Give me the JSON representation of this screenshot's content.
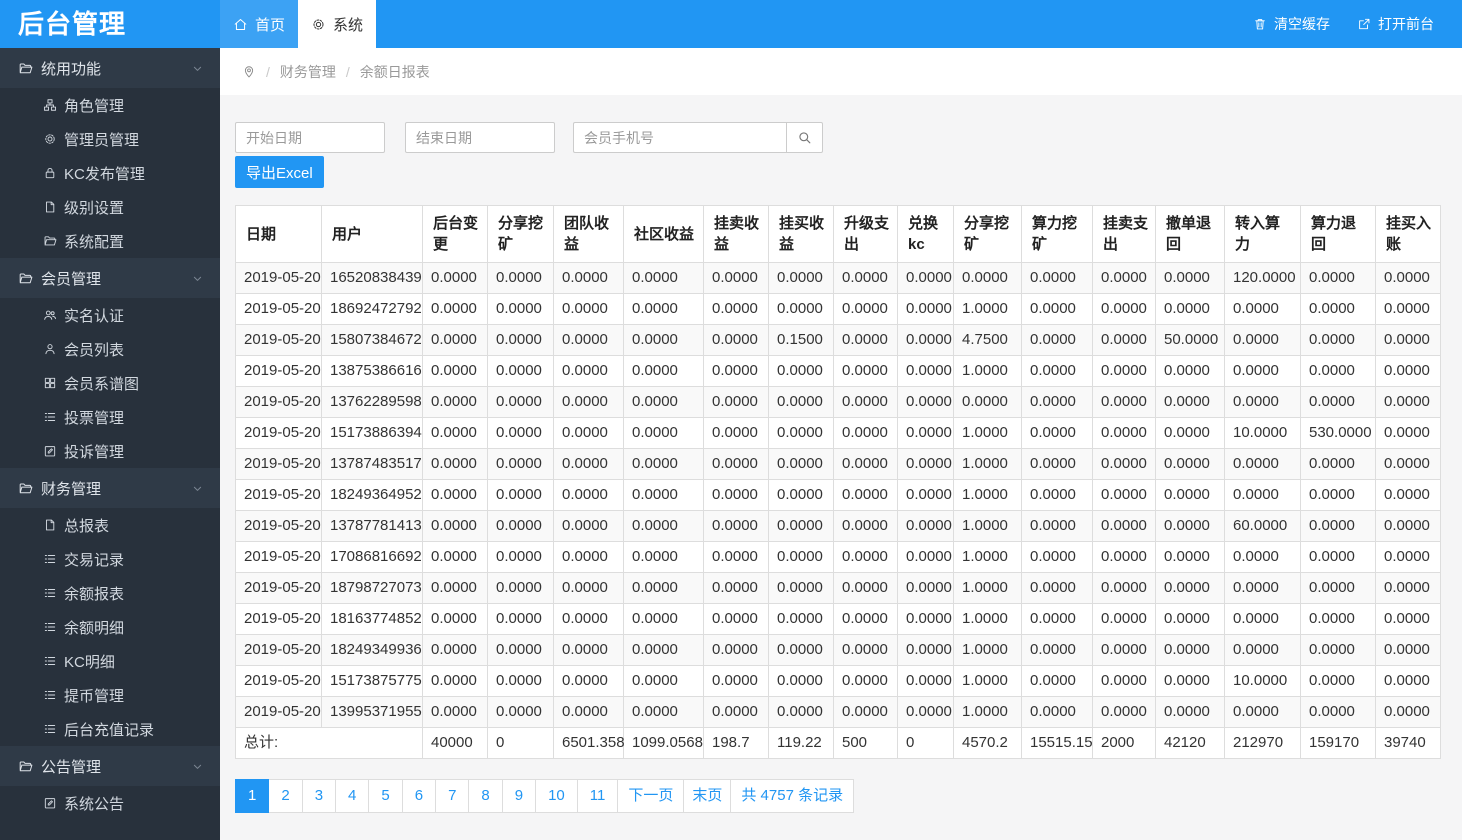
{
  "app": {
    "title": "后台管理"
  },
  "topbar": {
    "tabs": [
      {
        "label": "首页",
        "icon": "home-icon",
        "active": false
      },
      {
        "label": "系统",
        "icon": "gear-icon",
        "active": true
      }
    ],
    "actions": [
      {
        "label": "清空缓存",
        "icon": "trash-icon"
      },
      {
        "label": "打开前台",
        "icon": "external-link-icon"
      }
    ]
  },
  "sidebar": {
    "sections": [
      {
        "label": "统用功能",
        "icon": "folder-icon",
        "expanded": true,
        "items": [
          {
            "label": "角色管理",
            "icon": "sitemap-icon"
          },
          {
            "label": "管理员管理",
            "icon": "gear-icon"
          },
          {
            "label": "KC发布管理",
            "icon": "lock-icon"
          },
          {
            "label": "级别设置",
            "icon": "file-icon"
          },
          {
            "label": "系统配置",
            "icon": "folder-icon"
          }
        ]
      },
      {
        "label": "会员管理",
        "icon": "folder-icon",
        "expanded": true,
        "items": [
          {
            "label": "实名认证",
            "icon": "users-icon"
          },
          {
            "label": "会员列表",
            "icon": "user-icon"
          },
          {
            "label": "会员系谱图",
            "icon": "grid-icon"
          },
          {
            "label": "投票管理",
            "icon": "list-icon"
          },
          {
            "label": "投诉管理",
            "icon": "edit-square-icon"
          }
        ]
      },
      {
        "label": "财务管理",
        "icon": "folder-icon",
        "expanded": true,
        "items": [
          {
            "label": "总报表",
            "icon": "file-icon"
          },
          {
            "label": "交易记录",
            "icon": "list-icon"
          },
          {
            "label": "余额报表",
            "icon": "list-icon"
          },
          {
            "label": "余额明细",
            "icon": "list-icon"
          },
          {
            "label": "KC明细",
            "icon": "list-icon"
          },
          {
            "label": "提币管理",
            "icon": "list-icon"
          },
          {
            "label": "后台充值记录",
            "icon": "list-icon"
          }
        ]
      },
      {
        "label": "公告管理",
        "icon": "folder-icon",
        "expanded": true,
        "items": [
          {
            "label": "系统公告",
            "icon": "edit-square-icon"
          }
        ]
      }
    ]
  },
  "breadcrumb": {
    "icon": "location-pin-icon",
    "items": [
      "财务管理",
      "余额日报表"
    ]
  },
  "filters": {
    "start_date_placeholder": "开始日期",
    "end_date_placeholder": "结束日期",
    "phone_placeholder": "会员手机号",
    "export_label": "导出Excel"
  },
  "table": {
    "columns": [
      "日期",
      "用户",
      "后台变更",
      "分享挖矿",
      "团队收益",
      "社区收益",
      "挂卖收益",
      "挂买收益",
      "升级支出",
      "兑换kc",
      "分享挖矿",
      "算力挖矿",
      "挂卖支出",
      "撤单退回",
      "转入算力",
      "算力退回",
      "挂买入账"
    ],
    "rows": [
      [
        "2019-05-20",
        "16520838439",
        "0.0000",
        "0.0000",
        "0.0000",
        "0.0000",
        "0.0000",
        "0.0000",
        "0.0000",
        "0.0000",
        "0.0000",
        "0.0000",
        "0.0000",
        "0.0000",
        "120.0000",
        "0.0000",
        "0.0000"
      ],
      [
        "2019-05-20",
        "18692472792",
        "0.0000",
        "0.0000",
        "0.0000",
        "0.0000",
        "0.0000",
        "0.0000",
        "0.0000",
        "0.0000",
        "1.0000",
        "0.0000",
        "0.0000",
        "0.0000",
        "0.0000",
        "0.0000",
        "0.0000"
      ],
      [
        "2019-05-20",
        "15807384672",
        "0.0000",
        "0.0000",
        "0.0000",
        "0.0000",
        "0.0000",
        "0.1500",
        "0.0000",
        "0.0000",
        "4.7500",
        "0.0000",
        "0.0000",
        "50.0000",
        "0.0000",
        "0.0000",
        "0.0000"
      ],
      [
        "2019-05-20",
        "13875386616",
        "0.0000",
        "0.0000",
        "0.0000",
        "0.0000",
        "0.0000",
        "0.0000",
        "0.0000",
        "0.0000",
        "1.0000",
        "0.0000",
        "0.0000",
        "0.0000",
        "0.0000",
        "0.0000",
        "0.0000"
      ],
      [
        "2019-05-20",
        "13762289598",
        "0.0000",
        "0.0000",
        "0.0000",
        "0.0000",
        "0.0000",
        "0.0000",
        "0.0000",
        "0.0000",
        "0.0000",
        "0.0000",
        "0.0000",
        "0.0000",
        "0.0000",
        "0.0000",
        "0.0000"
      ],
      [
        "2019-05-20",
        "15173886394",
        "0.0000",
        "0.0000",
        "0.0000",
        "0.0000",
        "0.0000",
        "0.0000",
        "0.0000",
        "0.0000",
        "1.0000",
        "0.0000",
        "0.0000",
        "0.0000",
        "10.0000",
        "530.0000",
        "0.0000"
      ],
      [
        "2019-05-20",
        "13787483517",
        "0.0000",
        "0.0000",
        "0.0000",
        "0.0000",
        "0.0000",
        "0.0000",
        "0.0000",
        "0.0000",
        "1.0000",
        "0.0000",
        "0.0000",
        "0.0000",
        "0.0000",
        "0.0000",
        "0.0000"
      ],
      [
        "2019-05-20",
        "18249364952",
        "0.0000",
        "0.0000",
        "0.0000",
        "0.0000",
        "0.0000",
        "0.0000",
        "0.0000",
        "0.0000",
        "1.0000",
        "0.0000",
        "0.0000",
        "0.0000",
        "0.0000",
        "0.0000",
        "0.0000"
      ],
      [
        "2019-05-20",
        "13787781413",
        "0.0000",
        "0.0000",
        "0.0000",
        "0.0000",
        "0.0000",
        "0.0000",
        "0.0000",
        "0.0000",
        "1.0000",
        "0.0000",
        "0.0000",
        "0.0000",
        "60.0000",
        "0.0000",
        "0.0000"
      ],
      [
        "2019-05-20",
        "17086816692",
        "0.0000",
        "0.0000",
        "0.0000",
        "0.0000",
        "0.0000",
        "0.0000",
        "0.0000",
        "0.0000",
        "1.0000",
        "0.0000",
        "0.0000",
        "0.0000",
        "0.0000",
        "0.0000",
        "0.0000"
      ],
      [
        "2019-05-20",
        "18798727073",
        "0.0000",
        "0.0000",
        "0.0000",
        "0.0000",
        "0.0000",
        "0.0000",
        "0.0000",
        "0.0000",
        "1.0000",
        "0.0000",
        "0.0000",
        "0.0000",
        "0.0000",
        "0.0000",
        "0.0000"
      ],
      [
        "2019-05-20",
        "18163774852",
        "0.0000",
        "0.0000",
        "0.0000",
        "0.0000",
        "0.0000",
        "0.0000",
        "0.0000",
        "0.0000",
        "1.0000",
        "0.0000",
        "0.0000",
        "0.0000",
        "0.0000",
        "0.0000",
        "0.0000"
      ],
      [
        "2019-05-20",
        "18249349936",
        "0.0000",
        "0.0000",
        "0.0000",
        "0.0000",
        "0.0000",
        "0.0000",
        "0.0000",
        "0.0000",
        "1.0000",
        "0.0000",
        "0.0000",
        "0.0000",
        "0.0000",
        "0.0000",
        "0.0000"
      ],
      [
        "2019-05-20",
        "15173875775",
        "0.0000",
        "0.0000",
        "0.0000",
        "0.0000",
        "0.0000",
        "0.0000",
        "0.0000",
        "0.0000",
        "1.0000",
        "0.0000",
        "0.0000",
        "0.0000",
        "10.0000",
        "0.0000",
        "0.0000"
      ],
      [
        "2019-05-20",
        "13995371955",
        "0.0000",
        "0.0000",
        "0.0000",
        "0.0000",
        "0.0000",
        "0.0000",
        "0.0000",
        "0.0000",
        "1.0000",
        "0.0000",
        "0.0000",
        "0.0000",
        "0.0000",
        "0.0000",
        "0.0000"
      ]
    ],
    "total_label": "总计:",
    "totals": [
      "40000",
      "0",
      "6501.358",
      "1099.0568",
      "198.7",
      "119.22",
      "500",
      "0",
      "4570.2",
      "15515.15",
      "2000",
      "42120",
      "212970",
      "159170",
      "39740"
    ]
  },
  "pagination": {
    "pages": [
      "1",
      "2",
      "3",
      "4",
      "5",
      "6",
      "7",
      "8",
      "9",
      "10",
      "11"
    ],
    "active": "1",
    "next_label": "下一页",
    "last_label": "末页",
    "total_label": "共 4757 条记录"
  },
  "colors": {
    "primary": "#2196f3",
    "sidebar_bg": "#28313c",
    "sidebar_header_bg": "#2f3a47",
    "row_stripe": "#f9f9f9",
    "border": "#dddddd"
  }
}
